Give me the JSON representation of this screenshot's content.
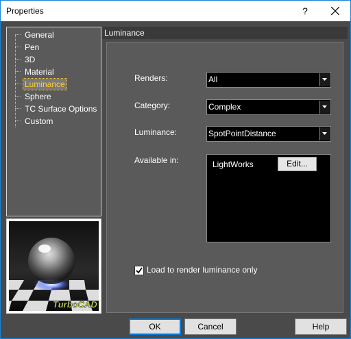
{
  "window": {
    "title": "Properties",
    "help_label": "?"
  },
  "tree": {
    "items": [
      {
        "label": "General"
      },
      {
        "label": "Pen"
      },
      {
        "label": "3D"
      },
      {
        "label": "Material"
      },
      {
        "label": "Luminance",
        "selected": true
      },
      {
        "label": "Sphere"
      },
      {
        "label": "TC Surface Options"
      },
      {
        "label": "Custom"
      }
    ]
  },
  "preview": {
    "logo_text": "TurboCAD"
  },
  "page": {
    "title": "Luminance",
    "renders": {
      "label": "Renders:",
      "value": "All"
    },
    "category": {
      "label": "Category:",
      "value": "Complex"
    },
    "luminance": {
      "label": "Luminance:",
      "value": "SpotPointDistance"
    },
    "available": {
      "label": "Available in:",
      "item": "LightWorks",
      "edit_label": "Edit..."
    },
    "checkbox": {
      "label": "Load to render luminance only",
      "checked": true
    }
  },
  "buttons": {
    "ok": "OK",
    "cancel": "Cancel",
    "help": "Help"
  },
  "colors": {
    "accent": "#0078d7",
    "selected_text": "#ffcc33"
  }
}
